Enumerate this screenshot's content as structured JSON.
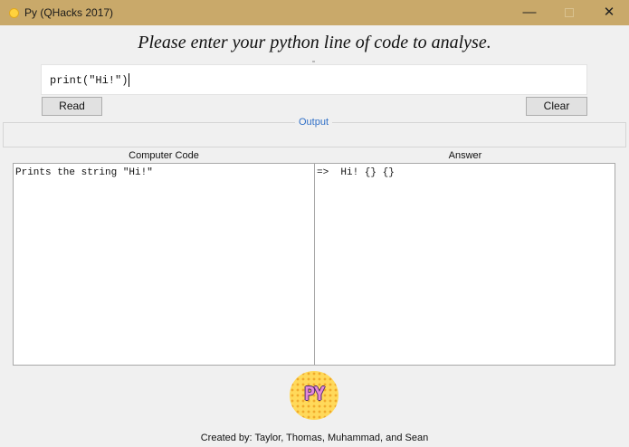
{
  "window": {
    "title": "Py (QHacks 2017)",
    "minimize_glyph": "—",
    "close_glyph": "✕",
    "app_icon": "app-icon",
    "accent": "#c9a96a"
  },
  "prompt": "Please enter your python line of code to analyse.",
  "code_input": {
    "value": "print(\"Hi!\")"
  },
  "buttons": {
    "read": "Read",
    "clear": "Clear"
  },
  "output": {
    "label": "Output",
    "label_color": "#2f6fc7"
  },
  "columns": {
    "left_header": "Computer Code",
    "right_header": "Answer"
  },
  "panels": {
    "computer_code": "Prints the string \"Hi!\"",
    "answer": "=>  Hi! {} {}"
  },
  "logo": {
    "text": "PY",
    "icon": "py-logo"
  },
  "credits": "Created by: Taylor, Thomas, Muhammad, and Sean"
}
